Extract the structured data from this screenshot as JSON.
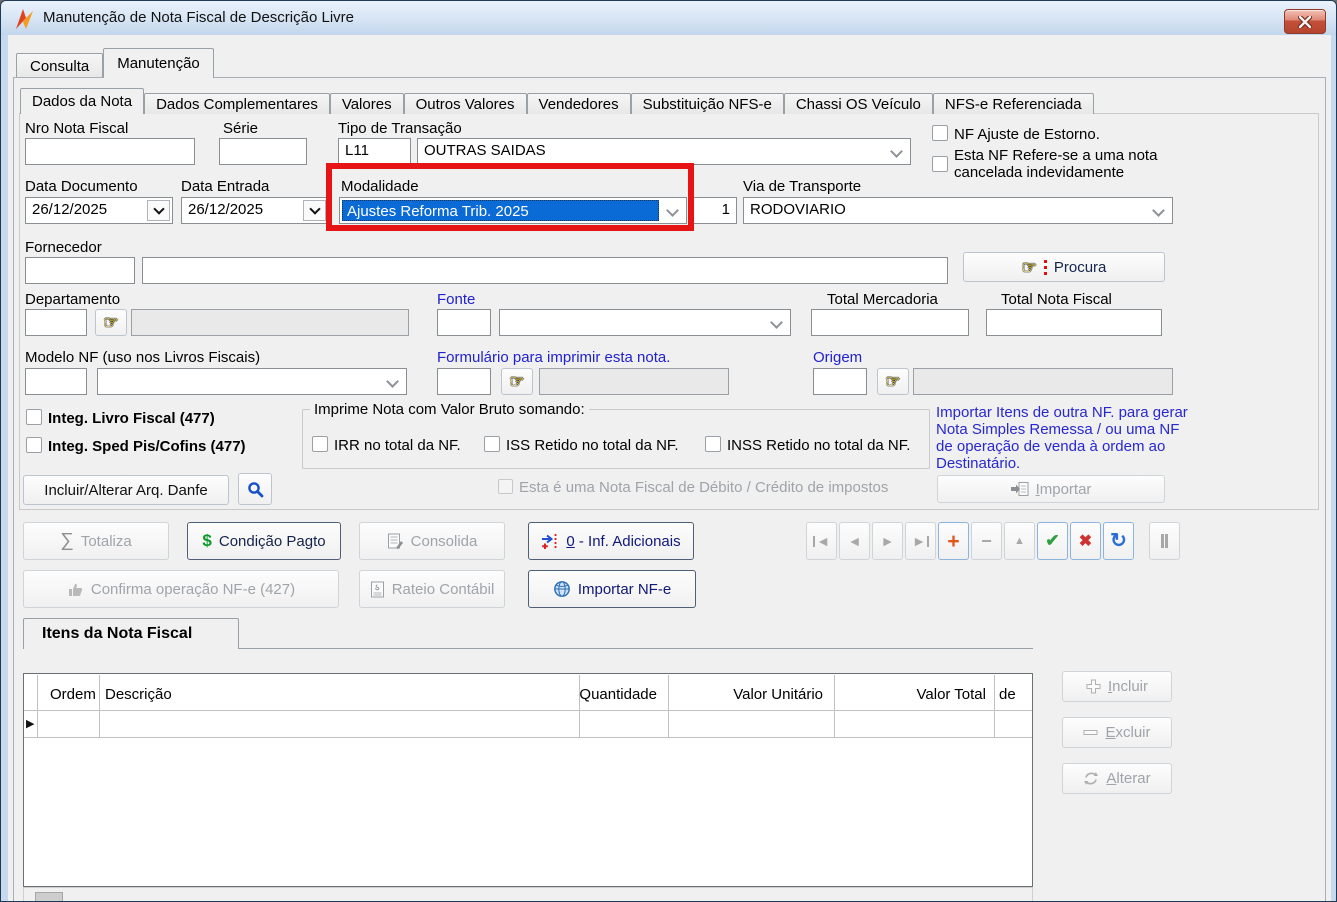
{
  "titlebar": {
    "title": "Manutenção de Nota Fiscal de Descrição Livre"
  },
  "main_tabs": {
    "consulta": "Consulta",
    "manutencao": "Manutenção"
  },
  "sub_tabs": [
    "Dados da Nota",
    "Dados Complementares",
    "Valores",
    "Outros Valores",
    "Vendedores",
    "Substituição NFS-e",
    "Chassi OS Veículo",
    "NFS-e Referenciada"
  ],
  "form": {
    "nro_label": "Nro Nota Fiscal",
    "serie_label": "Série",
    "tipo_label": "Tipo de Transação",
    "tipo_code": "L11",
    "tipo_value": "OUTRAS SAIDAS",
    "cb_ajuste": "NF Ajuste de Estorno.",
    "cb_cancelada_1": "Esta NF Refere-se a uma nota",
    "cb_cancelada_2": "cancelada indevidamente",
    "data_doc_label": "Data Documento",
    "data_doc_value": "26/12/2025",
    "data_ent_label": "Data Entrada",
    "data_ent_value": "26/12/2025",
    "modalidade_label": "Modalidade",
    "modalidade_value": "Ajustes Reforma Trib. 2025",
    "via_label": "Via de Transporte",
    "via_code": "1",
    "via_value": "RODOVIARIO",
    "fornecedor_label": "Fornecedor",
    "procura": "Procura",
    "departamento_label": "Departamento",
    "fonte_label": "Fonte",
    "total_merc_label": "Total Mercadoria",
    "total_nf_label": "Total Nota Fiscal",
    "modelo_label": "Modelo NF (uso nos Livros Fiscais)",
    "formulario_label": "Formulário para imprimir esta nota.",
    "origem_label": "Origem",
    "cb_integ_livro": "Integ. Livro Fiscal (477)",
    "cb_integ_sped": "Integ. Sped Pis/Cofins (477)",
    "group_title": "Imprime Nota com Valor Bruto somando:",
    "cb_irr": "IRR no total da NF.",
    "cb_iss": "ISS Retido no total da NF.",
    "cb_inss": "INSS Retido no total da NF.",
    "danfe_button": "Incluir/Alterar Arq. Danfe",
    "cb_debito": "Esta é uma Nota Fiscal de Débito / Crédito de impostos",
    "info_1": "Importar Itens de outra NF. para gerar",
    "info_2": "Nota Simples Remessa / ou uma NF",
    "info_3": "de operação de venda à ordem ao",
    "info_4": "Destinatário.",
    "importar_first": "I",
    "importar_rest": "mportar"
  },
  "toolbar": {
    "totaliza": "Totaliza",
    "condicao": "Condição Pagto",
    "consolida": "Consolida",
    "inf_num": "0",
    "inf_rest": " - Inf. Adicionais",
    "confirma": "Confirma operação NF-e (427)",
    "rateio": "Rateio Contábil",
    "importar_nfe": "Importar NF-e"
  },
  "items": {
    "tab": "Itens da Nota Fiscal",
    "columns": [
      "Ordem",
      "Descrição",
      "Quantidade",
      "Valor Unitário",
      "Valor Total",
      "de"
    ],
    "incluir_first": "I",
    "incluir_rest": "ncluir",
    "excluir_first": "E",
    "excluir_rest": "xcluir",
    "alterar_first": "A",
    "alterar_rest": "lterar"
  },
  "icons": {
    "hand": "☞",
    "sigma": "∑",
    "dollar": "$",
    "row_indicator": "▶",
    "nav": [
      "◄",
      "◄",
      "►",
      "►",
      "+",
      "−",
      "▲",
      "✔",
      "✖",
      "↻"
    ]
  },
  "colors": {
    "highlight_blue": "#0a6bd7",
    "annotation_red": "#e61414",
    "label_blue": "#2121cf"
  }
}
